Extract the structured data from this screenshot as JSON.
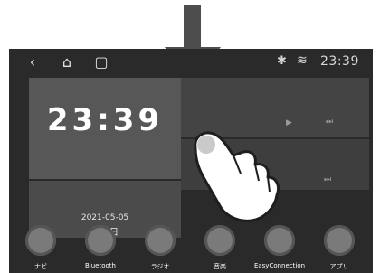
{
  "status": {
    "time": "23:39",
    "nav": [
      "back-icon",
      "home-icon",
      "recents-icon"
    ],
    "right_icons": [
      "bluetooth-icon",
      "wifi-icon"
    ]
  },
  "clock": {
    "time": "23:39",
    "date": "2021-05-05",
    "weekday": "水曜日"
  },
  "media": {
    "controls_top": [
      "▶",
      "⏭"
    ],
    "controls_bottom": [
      "⏮",
      "⏭"
    ]
  },
  "dock": [
    {
      "label": "ナビ",
      "icon": "navigation-icon"
    },
    {
      "label": "Bluetooth",
      "icon": "bluetooth-icon"
    },
    {
      "label": "ラジオ",
      "icon": "radio-icon"
    },
    {
      "label": "音楽",
      "icon": "music-icon"
    },
    {
      "label": "EasyConnection",
      "icon": "easyconnection-icon"
    },
    {
      "label": "アプリ",
      "icon": "apps-icon"
    }
  ]
}
